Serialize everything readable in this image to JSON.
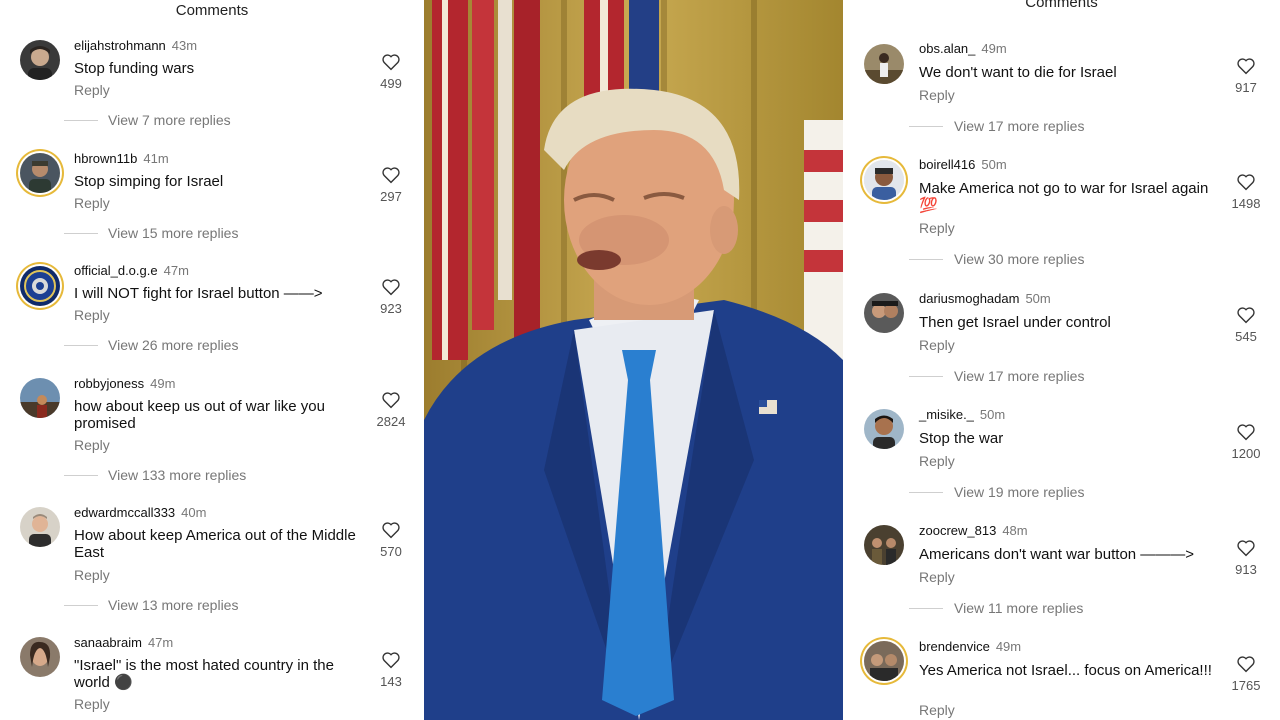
{
  "left": {
    "title": "Comments",
    "comments": [
      {
        "user": "elijahstrohmann",
        "time": "43m",
        "text": "Stop funding wars",
        "reply": "Reply",
        "likes": "499",
        "more": "View 7 more replies"
      },
      {
        "user": "hbrown11b",
        "time": "41m",
        "text": "Stop simping for Israel",
        "reply": "Reply",
        "likes": "297",
        "more": "View 15 more replies"
      },
      {
        "user": "official_d.o.g.e",
        "time": "47m",
        "text": "I will NOT fight for Israel button ——>",
        "reply": "Reply",
        "likes": "923",
        "more": "View 26 more replies"
      },
      {
        "user": "robbyjoness",
        "time": "49m",
        "text": "how about keep us out of war like you promised",
        "reply": "Reply",
        "likes": "2824",
        "more": "View 133 more replies"
      },
      {
        "user": "edwardmccall333",
        "time": "40m",
        "text": "How about keep America out of the Middle East",
        "reply": "Reply",
        "likes": "570",
        "more": "View 13 more replies"
      },
      {
        "user": "sanaabraim",
        "time": "47m",
        "text": "\"Israel\" is the most hated country in the world ⚫",
        "reply": "Reply",
        "likes": "143"
      }
    ]
  },
  "right": {
    "title": "Comments",
    "comments": [
      {
        "user": "obs.alan_",
        "time": "49m",
        "text": "We don't want to die for Israel",
        "reply": "Reply",
        "likes": "917",
        "more": "View 17 more replies"
      },
      {
        "user": "boirell416",
        "time": "50m",
        "text": "Make America not go to war for Israel again 💯",
        "reply": "Reply",
        "likes": "1498",
        "more": "View 30 more replies"
      },
      {
        "user": "dariusmoghadam",
        "time": "50m",
        "text": "Then get Israel under control",
        "reply": "Reply",
        "likes": "545",
        "more": "View 17 more replies"
      },
      {
        "user": "_misike._",
        "time": "50m",
        "text": "Stop the war",
        "reply": "Reply",
        "likes": "1200",
        "more": "View 19 more replies"
      },
      {
        "user": "zoocrew_813",
        "time": "48m",
        "text": "Americans don't want war button ———>",
        "reply": "Reply",
        "likes": "913",
        "more": "View 11 more replies"
      },
      {
        "user": "brendenvice",
        "time": "49m",
        "text": "Yes America not Israel... focus on America!!!",
        "reply": "Reply",
        "likes": "1765"
      }
    ]
  },
  "colors": {
    "story_ring": "#e6b93a",
    "suit": "#1f3f8a",
    "tie": "#2a7fd0",
    "curtain": "#b8983a"
  }
}
